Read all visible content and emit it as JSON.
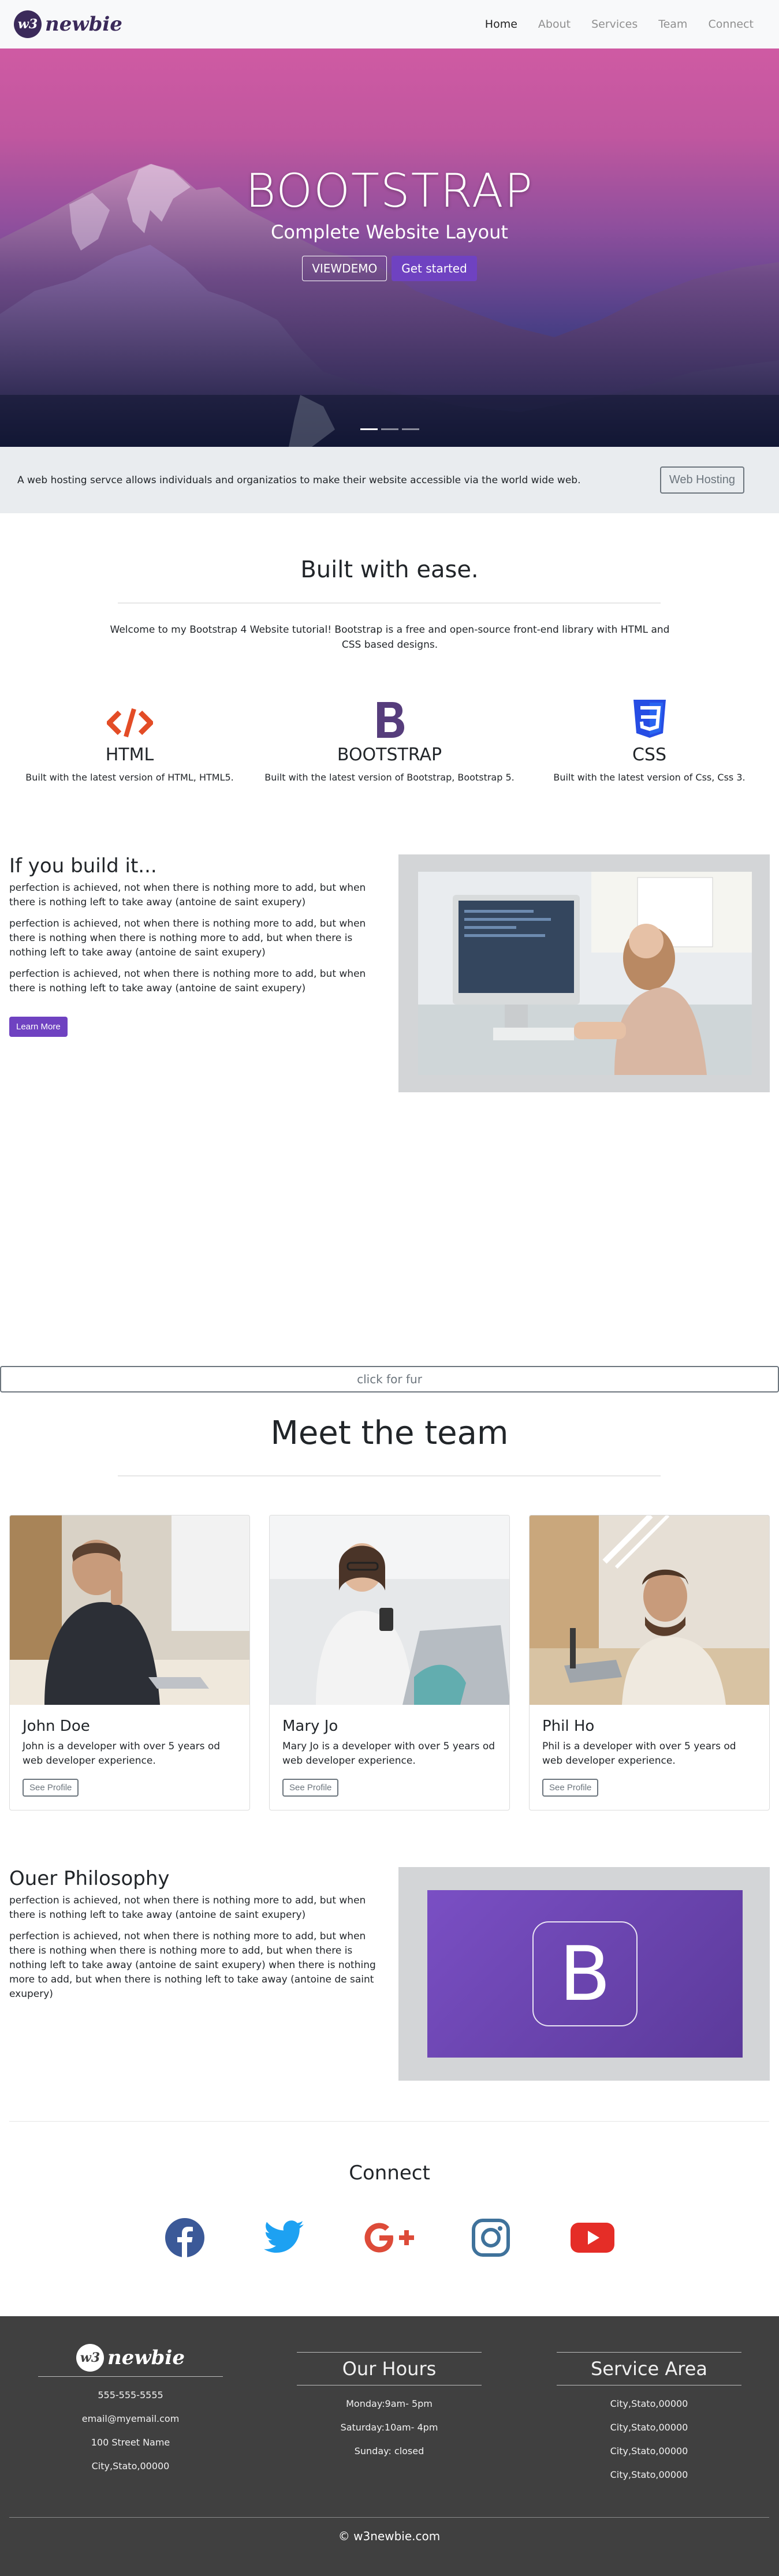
{
  "brand": {
    "badge": "w3",
    "name": "newbie"
  },
  "nav": {
    "items": [
      "Home",
      "About",
      "Services",
      "Team",
      "Connect"
    ],
    "active": "Home"
  },
  "hero": {
    "title": "BOOTSTRAP",
    "subtitle": "Complete Website Layout",
    "btn_demo": "VIEWDEMO",
    "btn_start": "Get started",
    "slides": 3,
    "active_slide": 1
  },
  "jumbotron": {
    "text": "A web hosting servce allows individuals and organizatios to make their website accessible via the world wide web.",
    "button": "Web Hosting"
  },
  "welcome": {
    "title": "Built with ease.",
    "text": "Welcome to my Bootstrap 4 Website tutorial! Bootstrap is a free and open-source front-end library with HTML and CSS based designs."
  },
  "features": [
    {
      "icon": "code-icon",
      "title": "HTML",
      "text": "Built with the latest version of HTML, HTML5.",
      "color": "#e34c26"
    },
    {
      "icon": "bootstrap-icon",
      "title": "BOOTSTRAP",
      "text": "Built with the latest version of Bootstrap, Bootstrap 5.",
      "color": "#563d7c"
    },
    {
      "icon": "css3-icon",
      "title": "CSS",
      "text": "Built with the latest version of Css, Css 3.",
      "color": "#264de4"
    }
  ],
  "build": {
    "title": "If you build it...",
    "paragraphs": [
      "perfection is achieved, not when there is nothing more to add, but when there is nothing left to take away (antoine de saint exupery)",
      "perfection is achieved, not when there is nothing more to add, but when there is nothing when there is nothing more to add, but when there is nothing left to take away (antoine de saint exupery)",
      "perfection is achieved, not when there is nothing more to add, but when there is nothing left to take away (antoine de saint exupery)"
    ],
    "button": "Learn More"
  },
  "collapse_button": "click for fur",
  "team": {
    "title": "Meet the team",
    "members": [
      {
        "name": "John Doe",
        "bio": "John is a developer with over 5 years od web developer experience.",
        "button": "See Profile"
      },
      {
        "name": "Mary Jo",
        "bio": "Mary Jo is a developer with over 5 years od web developer experience.",
        "button": "See Profile"
      },
      {
        "name": "Phil Ho",
        "bio": "Phil is a developer with over 5 years od web developer experience.",
        "button": "See Profile"
      }
    ]
  },
  "philosophy": {
    "title": "Ouer Philosophy",
    "paragraphs": [
      "perfection is achieved, not when there is nothing more to add, but when there is nothing left to take away (antoine de saint exupery)",
      "perfection is achieved, not when there is nothing more to add, but when there is nothing when there is nothing more to add, but when there is nothing left to take away (antoine de saint exupery) when there is nothing more to add, but when there is nothing left to take away (antoine de saint exupery)"
    ],
    "logo_letter": "B"
  },
  "connect": {
    "title": "Connect",
    "icons": [
      {
        "name": "facebook-icon",
        "color": "#3b5998"
      },
      {
        "name": "twitter-icon",
        "color": "#1da1f2"
      },
      {
        "name": "google-plus-icon",
        "color": "#dd4b39"
      },
      {
        "name": "instagram-icon",
        "color": "#3f729b"
      },
      {
        "name": "youtube-icon",
        "color": "#e52d27"
      }
    ]
  },
  "footer": {
    "contact": [
      "555-555-5555",
      "email@myemail.com",
      "100 Street Name",
      "City,Stato,00000"
    ],
    "hours_title": "Our Hours",
    "hours": [
      "Monday:9am- 5pm",
      "Saturday:10am- 4pm",
      "Sunday: closed"
    ],
    "area_title": "Service Area",
    "areas": [
      "City,Stato,00000",
      "City,Stato,00000",
      "City,Stato,00000",
      "City,Stato,00000"
    ],
    "copyright": "© w3newbie.com"
  }
}
